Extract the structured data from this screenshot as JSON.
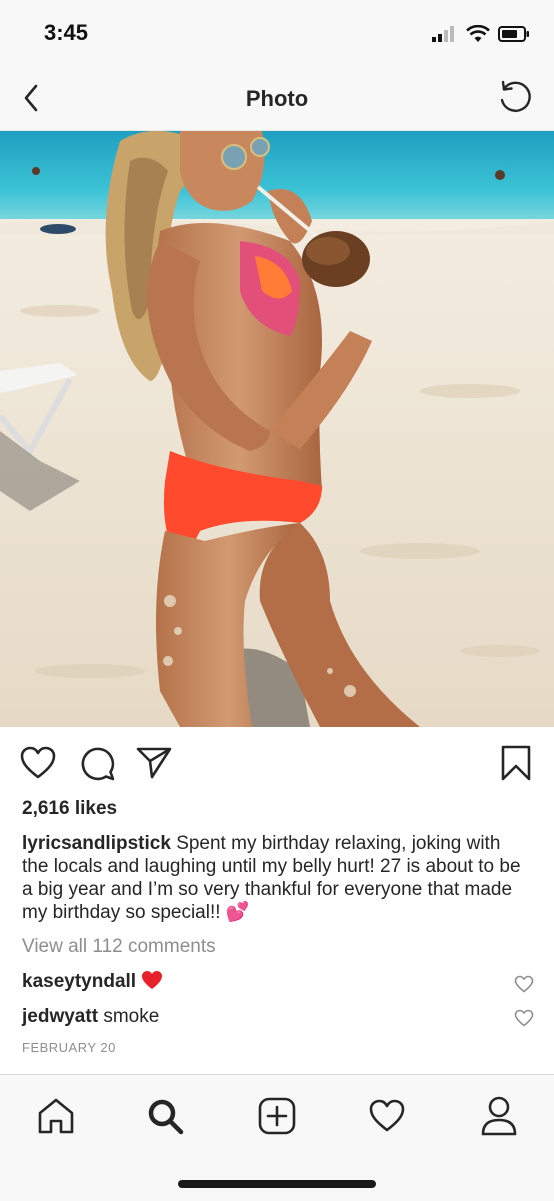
{
  "status_bar": {
    "time": "3:45"
  },
  "header": {
    "title": "Photo"
  },
  "post": {
    "likes": "2,616 likes",
    "caption_user": "lyricsandlipstick",
    "caption_text": "Spent my birthday relaxing, joking with the locals and laughing until my belly hurt! 27 is about to be a big year and I’m so very thankful for everyone that made my birthday so special!!",
    "caption_emoji": "💕",
    "view_all": "View all 112 comments",
    "comments": [
      {
        "user": "kaseytyndall",
        "text": ""
      },
      {
        "user": "jedwyatt",
        "text": "smoke"
      }
    ],
    "date": "FEBRUARY 20"
  },
  "colors": {
    "bikini": "#ff4a2e",
    "sea": "#3cc3d6",
    "sand": "#efe6d8"
  },
  "icons": [
    "back-icon",
    "refresh-icon",
    "heart-icon",
    "comment-icon",
    "share-icon",
    "bookmark-icon",
    "home-icon",
    "search-icon",
    "add-icon",
    "activity-icon",
    "profile-icon"
  ]
}
